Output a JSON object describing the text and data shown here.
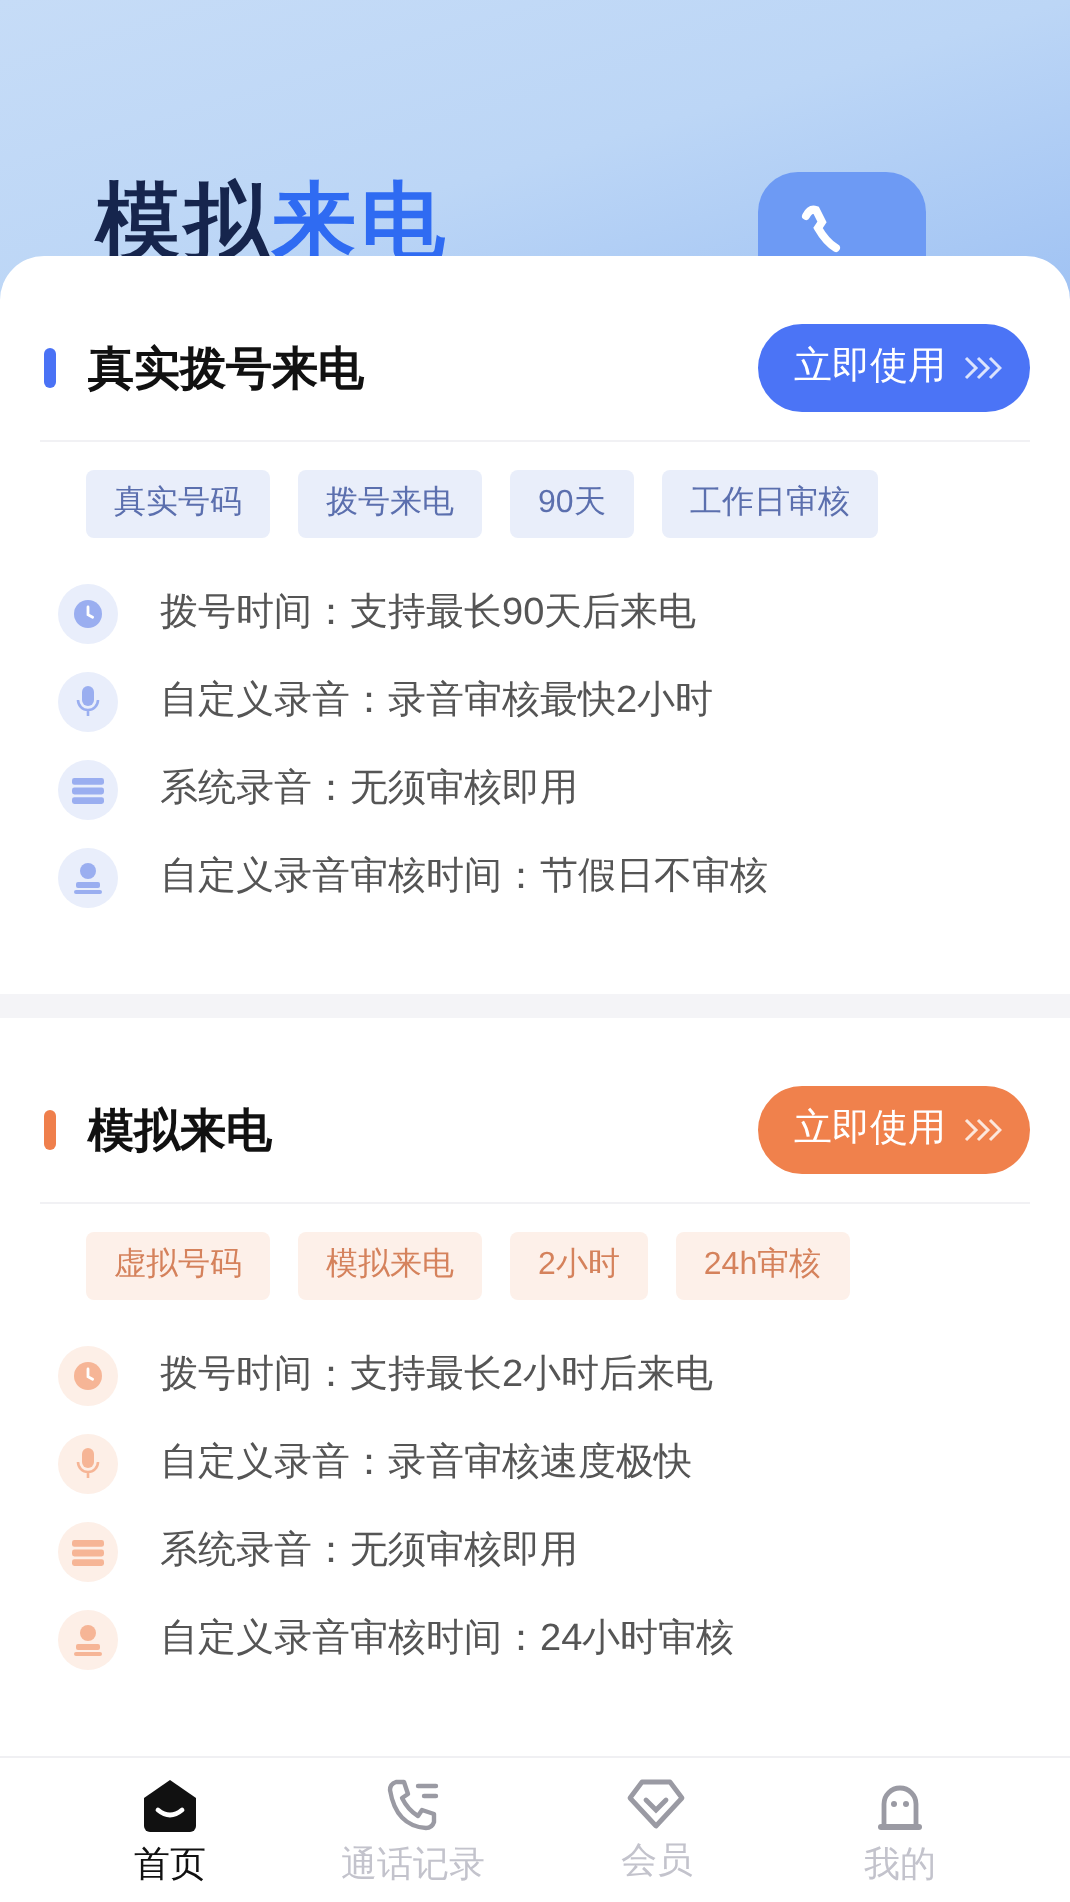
{
  "hero": {
    "title_parts": [
      {
        "text": "模拟",
        "kind": "dark"
      },
      {
        "text": "来电",
        "kind": "accent"
      }
    ]
  },
  "sections": [
    {
      "kind": "blue",
      "title": "真实拨号来电",
      "button": "立即使用",
      "tags": [
        "真实号码",
        "拨号来电",
        "90天",
        "工作日审核"
      ],
      "features": [
        {
          "kind": "clock",
          "text": "拨号时间：支持最长90天后来电"
        },
        {
          "kind": "mic",
          "text": "自定义录音：录音审核最快2小时"
        },
        {
          "kind": "list",
          "text": "系统录音：无须审核即用"
        },
        {
          "kind": "person",
          "text": "自定义录音审核时间：节假日不审核"
        }
      ]
    },
    {
      "kind": "orange",
      "title": "模拟来电",
      "button": "立即使用",
      "tags": [
        "虚拟号码",
        "模拟来电",
        "2小时",
        "24h审核"
      ],
      "features": [
        {
          "kind": "clock",
          "text": "拨号时间：支持最长2小时后来电"
        },
        {
          "kind": "mic",
          "text": "自定义录音：录音审核速度极快"
        },
        {
          "kind": "list",
          "text": "系统录音：无须审核即用"
        },
        {
          "kind": "person",
          "text": "自定义录音审核时间：24小时审核"
        }
      ]
    }
  ],
  "nav": [
    {
      "kind": "home",
      "label": "首页",
      "selected": true
    },
    {
      "kind": "calls",
      "label": "通话记录",
      "selected": false
    },
    {
      "kind": "vip",
      "label": "会员",
      "selected": false
    },
    {
      "kind": "me",
      "label": "我的",
      "selected": false
    }
  ]
}
